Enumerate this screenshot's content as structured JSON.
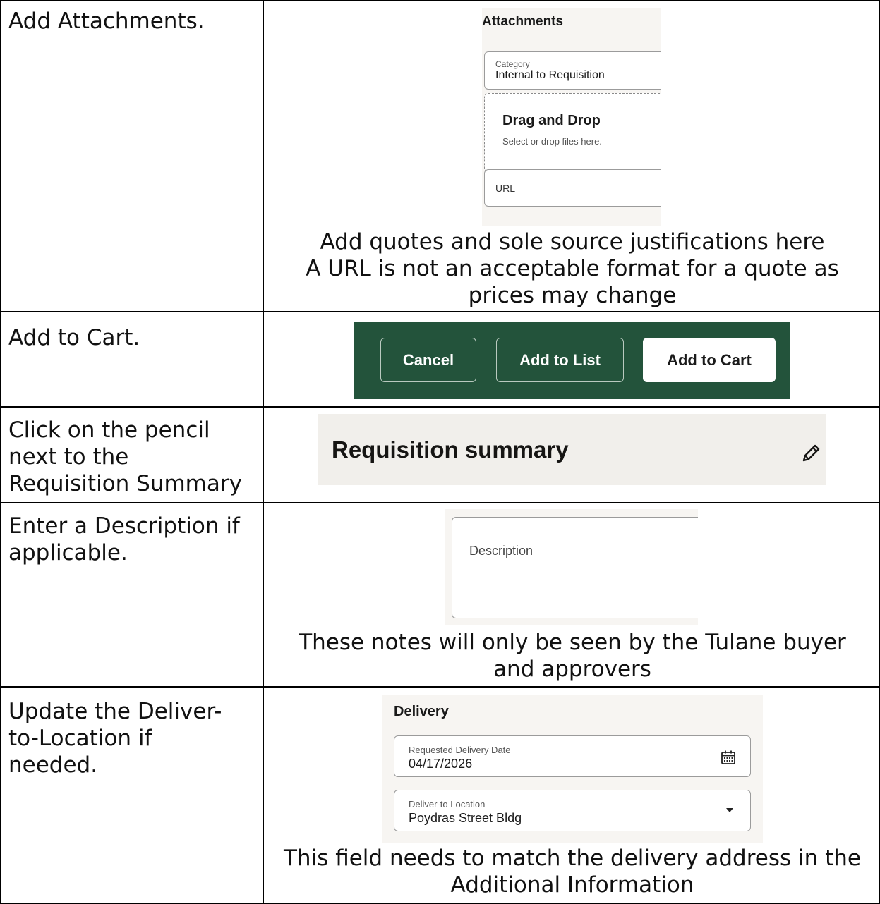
{
  "rows": [
    {
      "step": "Add Attachments.",
      "notes": [
        "Add quotes and sole source justifications here",
        "A URL is not an acceptable format for a quote as",
        "prices may change"
      ]
    },
    {
      "step": "Add to Cart."
    },
    {
      "step_lines": [
        "Click on the pencil",
        "next to the",
        "Requisition Summary"
      ]
    },
    {
      "step_lines": [
        "Enter a Description if",
        "applicable."
      ],
      "notes": [
        "These notes will only be seen by the Tulane buyer",
        "and approvers"
      ]
    },
    {
      "step_lines": [
        "Update the Deliver-",
        "to-Location if",
        "needed."
      ],
      "notes": [
        "This field needs to match the delivery address in the",
        "Additional Information"
      ]
    }
  ],
  "attachments": {
    "title": "Attachments",
    "category_label": "Category",
    "category_value": "Internal to Requisition",
    "drop_title": "Drag and Drop",
    "drop_sub": "Select or drop files here.",
    "url_label": "URL"
  },
  "cart": {
    "cancel": "Cancel",
    "add_to_list": "Add to List",
    "add_to_cart": "Add to Cart",
    "bar_color": "#23533b"
  },
  "req_summary": {
    "title": "Requisition summary",
    "edit_icon": "pencil-icon"
  },
  "description": {
    "label": "Description"
  },
  "delivery": {
    "title": "Delivery",
    "date_label": "Requested Delivery Date",
    "date_value": "04/17/2026",
    "date_icon": "calendar-icon",
    "location_label": "Deliver-to Location",
    "location_value": "Poydras Street Bldg",
    "location_icon": "chevron-down-icon"
  }
}
